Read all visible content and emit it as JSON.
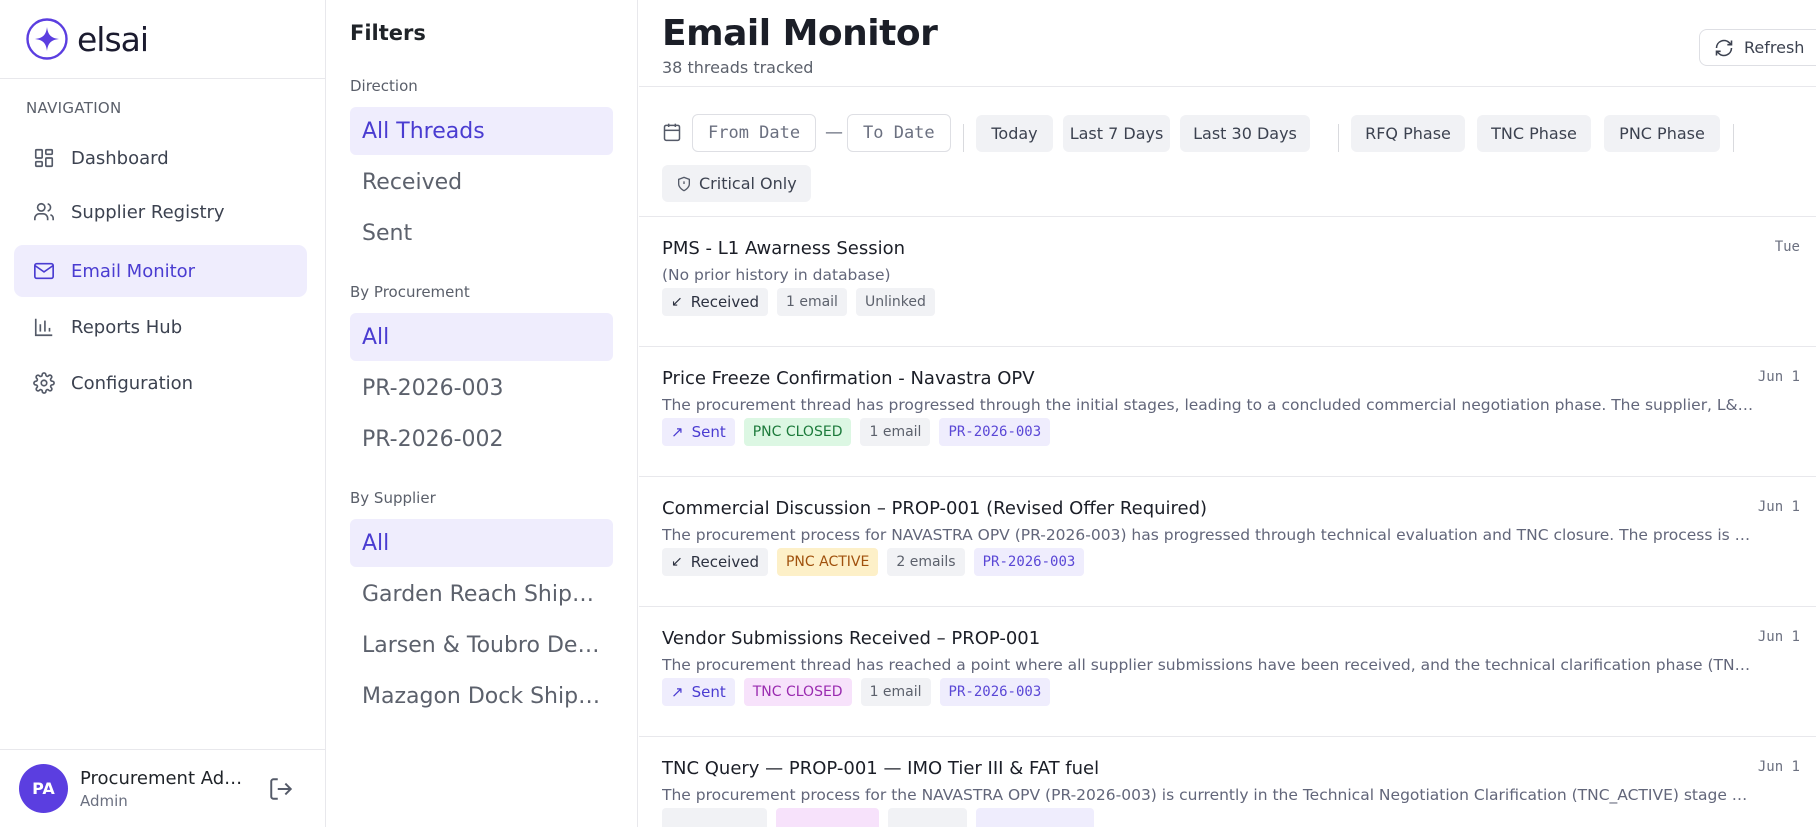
{
  "brand": {
    "name": "elsai"
  },
  "nav": {
    "title": "NAVIGATION",
    "items": [
      {
        "label": "Dashboard",
        "icon": "dashboard-icon"
      },
      {
        "label": "Supplier Registry",
        "icon": "users-icon"
      },
      {
        "label": "Email Monitor",
        "icon": "mail-icon",
        "active": true
      },
      {
        "label": "Reports Hub",
        "icon": "bar-chart-icon"
      },
      {
        "label": "Configuration",
        "icon": "gear-icon"
      }
    ]
  },
  "user": {
    "initials": "PA",
    "name": "Procurement Admin",
    "role": "Admin"
  },
  "filters": {
    "title": "Filters",
    "direction": {
      "label": "Direction",
      "items": [
        "All Threads",
        "Received",
        "Sent"
      ]
    },
    "procurement": {
      "label": "By Procurement",
      "items": [
        "All",
        "PR-2026-003",
        "PR-2026-002"
      ]
    },
    "supplier": {
      "label": "By Supplier",
      "items": [
        "All",
        "Garden Reach Shipbuilders",
        "Larsen & Toubro Defence",
        "Mazagon Dock Shipbuilders"
      ]
    }
  },
  "header": {
    "title": "Email Monitor",
    "subtitle": "38 threads tracked",
    "refresh_label": "Refresh"
  },
  "toolbar": {
    "from_placeholder": "From Date",
    "to_placeholder": "To Date",
    "dash": "—",
    "quick": [
      "Today",
      "Last 7 Days",
      "Last 30 Days"
    ],
    "phases": [
      "RFQ Phase",
      "TNC Phase",
      "PNC Phase"
    ],
    "critical": "Critical Only"
  },
  "threads": [
    {
      "title": "PMS - L1 Awarness Session",
      "date": "Tue",
      "summary": "(No prior history in database)",
      "direction": "Received",
      "status": "",
      "count": "1 email",
      "pr": "Unlinked"
    },
    {
      "title": "Price Freeze Confirmation - Navastra OPV",
      "date": "Jun 1",
      "summary": "The procurement thread has progressed through the initial stages, leading to a concluded commercial negotiation phase. The supplier, L&T Defence, has confirmed the revised pricing and agreed to a price freeze.",
      "direction": "Sent",
      "status": "PNC CLOSED",
      "count": "1 email",
      "pr": "PR-2026-003"
    },
    {
      "title": "Commercial Discussion – PROP-001 (Revised Offer Required)",
      "date": "Jun 1",
      "summary": "The procurement process for NAVASTRA OPV (PR-2026-003) has progressed through technical evaluation and TNC closure. The process is now in the commercial negotiation phase.",
      "direction": "Received",
      "status": "PNC ACTIVE",
      "count": "2 emails",
      "pr": "PR-2026-003"
    },
    {
      "title": "Vendor Submissions Received – PROP-001",
      "date": "Jun 1",
      "summary": "The procurement thread has reached a point where all supplier submissions have been received, and the technical clarification phase (TNC) has been closed.",
      "direction": "Sent",
      "status": "TNC CLOSED",
      "count": "1 email",
      "pr": "PR-2026-003"
    },
    {
      "title": "TNC Query — PROP-001 — IMO Tier III & FAT fuel",
      "date": "Jun 1",
      "summary": "The procurement process for the NAVASTRA OPV (PR-2026-003) is currently in the Technical Negotiation Clarification (TNC_ACTIVE) stage with open queries.",
      "direction": "",
      "status": "",
      "count": "",
      "pr": ""
    }
  ]
}
